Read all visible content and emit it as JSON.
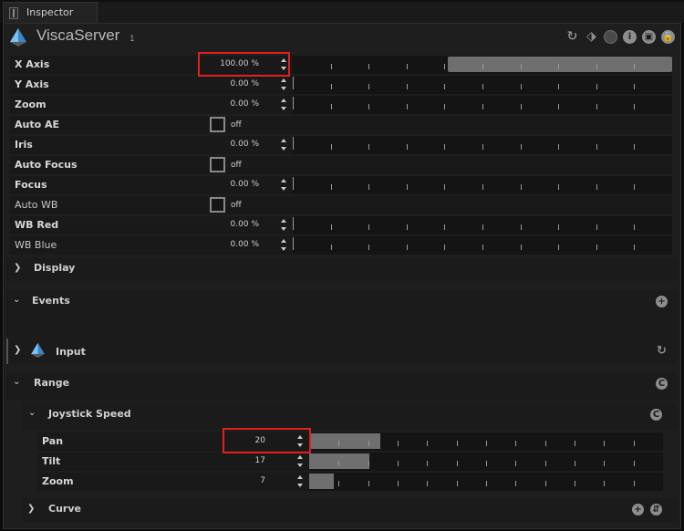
{
  "tab": {
    "label": "Inspector"
  },
  "header": {
    "title": "ViscaServer",
    "subtitle": "1",
    "icons": [
      "refresh-icon",
      "tag-icon",
      "record-icon",
      "info-icon",
      "save-icon",
      "lock-icon"
    ]
  },
  "parameters": [
    {
      "label": "X Axis",
      "type": "float",
      "value": "100.00 %",
      "fraction": 1.0,
      "bold": true
    },
    {
      "label": "Y Axis",
      "type": "float",
      "value": "0.00 %",
      "fraction": 0.0,
      "bold": true
    },
    {
      "label": "Zoom",
      "type": "float",
      "value": "0.00 %",
      "fraction": 0.0,
      "bold": true
    },
    {
      "label": "Auto AE",
      "type": "bool",
      "value": "off",
      "bold": true
    },
    {
      "label": "Iris",
      "type": "float",
      "value": "0.00 %",
      "fraction": 0.0,
      "bold": true
    },
    {
      "label": "Auto Focus",
      "type": "bool",
      "value": "off",
      "bold": true
    },
    {
      "label": "Focus",
      "type": "float",
      "value": "0.00 %",
      "fraction": 0.0,
      "bold": true
    },
    {
      "label": "Auto WB",
      "type": "bool",
      "value": "off",
      "bold": false
    },
    {
      "label": "WB Red",
      "type": "float",
      "value": "0.00 %",
      "fraction": 0.0,
      "bold": true
    },
    {
      "label": "WB Blue",
      "type": "float",
      "value": "0.00 %",
      "fraction": 0.0,
      "bold": false
    }
  ],
  "sections": {
    "display": {
      "label": "Display"
    },
    "events": {
      "label": "Events"
    },
    "input": {
      "label": "Input"
    },
    "range": {
      "label": "Range"
    },
    "joystick": {
      "label": "Joystick Speed"
    },
    "curve": {
      "label": "Curve"
    }
  },
  "joystick_params": [
    {
      "label": "Pan",
      "value": "20",
      "fraction": 0.2
    },
    {
      "label": "Tilt",
      "value": "17",
      "fraction": 0.17
    },
    {
      "label": "Zoom",
      "value": "7",
      "fraction": 0.07
    }
  ],
  "colors": {
    "highlight": "#e0201c",
    "accent": "#3b86c6",
    "fill": "#6f6f6f"
  }
}
